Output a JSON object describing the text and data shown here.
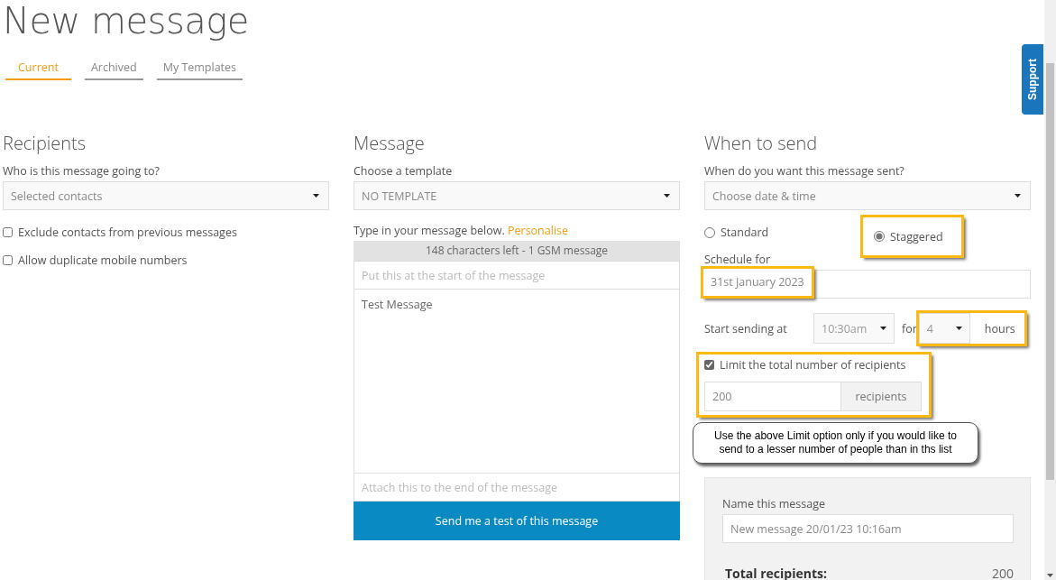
{
  "page_title": "New message",
  "tabs": [
    {
      "label": "Current",
      "selected": true
    },
    {
      "label": "Archived",
      "selected": false
    },
    {
      "label": "My Templates",
      "selected": false
    }
  ],
  "recipients": {
    "heading": "Recipients",
    "field_label": "Who is this message going to?",
    "select": "Selected contacts",
    "options": [
      {
        "label": "Exclude contacts from previous messages",
        "checked": false
      },
      {
        "label": "Allow duplicate mobile numbers",
        "checked": false
      }
    ]
  },
  "message": {
    "heading": "Message",
    "template_label": "Choose a template",
    "template": "NO TEMPLATE",
    "prompt": "Type in your message below.",
    "personalise_link": "Personalise",
    "counter": "148 characters left - 1 GSM message",
    "prefix_placeholder": "Put this at the start of the message",
    "body": "Test Message",
    "suffix_placeholder": "Attach this to the end of the message",
    "test_button": "Send me a test of this message"
  },
  "when": {
    "heading": "When to send",
    "field_label": "When do you want this message sent?",
    "select": "Choose date & time",
    "modes": [
      {
        "label": "Standard",
        "selected": false,
        "highlighted": false
      },
      {
        "label": "Staggered",
        "selected": true,
        "highlighted": true
      }
    ],
    "schedule_label": "Schedule for",
    "schedule_date": "31st January 2023",
    "schedule_highlighted": true,
    "start_label": "Start sending at",
    "start_time": "10:30am",
    "for_label": "for",
    "duration": "4",
    "unit": "hours",
    "duration_highlighted": true,
    "limit": {
      "label": "Limit the total number of recipients",
      "checked": true,
      "value": "200",
      "unit": "recipients",
      "highlighted": true
    },
    "note": "Use the above Limit option only if you would like to send to a lesser number of people than in ths list",
    "summary": {
      "name_label": "Name this message",
      "name_value": "New message 20/01/23 10:16am",
      "total_label": "Total recipients:",
      "total_value": "200"
    }
  },
  "support_tab": "Support"
}
